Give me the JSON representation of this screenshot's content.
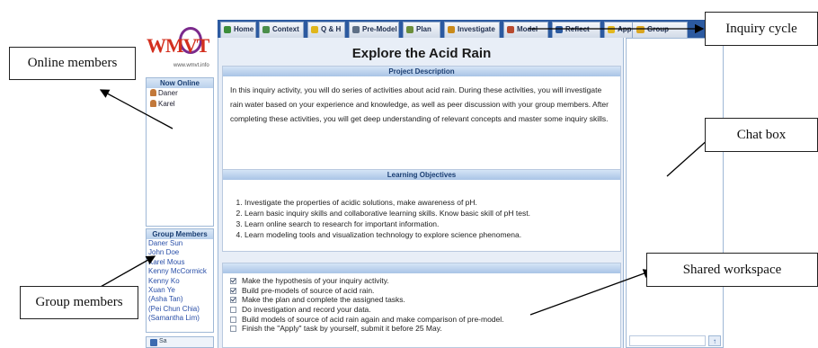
{
  "logo": {
    "text": "WMVT",
    "url_text": "www.wmvt.info"
  },
  "online_panel": {
    "title": "Now Online",
    "users": [
      "Daner",
      "Karel"
    ]
  },
  "members_panel": {
    "title": "Group Members",
    "members": [
      "Daner Sun",
      "John Doe",
      "Karel Mous",
      "Kenny McCormick",
      "Kenny Ko",
      "Xuan Ye",
      "(Asha Tan)",
      "(Pei Chun Chia)",
      "(Samantha Lim)"
    ]
  },
  "bottom_button": {
    "label": "Sa"
  },
  "tabs": [
    {
      "label": "Home",
      "icon": "home-icon",
      "color": "#3c8d3a"
    },
    {
      "label": "Context",
      "icon": "globe-icon",
      "color": "#4a8e4a"
    },
    {
      "label": "Q & H",
      "icon": "question-icon",
      "color": "#e0b61c"
    },
    {
      "label": "Pre-Model",
      "icon": "model-icon",
      "color": "#5d6f86"
    },
    {
      "label": "Plan",
      "icon": "pencil-icon",
      "color": "#6b8e3a"
    },
    {
      "label": "Investigate",
      "icon": "flask-icon",
      "color": "#c98a1a"
    },
    {
      "label": "Model",
      "icon": "molecule-icon",
      "color": "#b84a2f"
    },
    {
      "label": "Reflect",
      "icon": "reflect-icon",
      "color": "#2c5aa0"
    },
    {
      "label": "Apply",
      "icon": "star-icon",
      "color": "#e3b81f"
    }
  ],
  "group_tab": {
    "label": "Group",
    "icon": "group-icon"
  },
  "main": {
    "title": "Explore the Acid Rain",
    "description": {
      "header": "Project Description",
      "text": "In this inquiry activity, you will do series of activities about acid rain. During these activities, you will investigate rain water based on your experience and knowledge, as well as peer discussion with your group members. After completing these activities, you will get deep understanding of relevant concepts and master some inquiry skills."
    },
    "objectives": {
      "header": "Learning Objectives",
      "items": [
        "Investigate the properties of acidic solutions, make awareness of pH.",
        "Learn basic inquiry skills and collaborative learning skills. Know basic skill of pH test.",
        "Learn online search to research for important information.",
        "Learn modeling tools and visualization technology to explore science phenomena."
      ]
    },
    "tasks": {
      "header": "",
      "items": [
        {
          "text": "Make the hypothesis of your inquiry activity.",
          "checked": true
        },
        {
          "text": "Build pre-models of source of acid rain.",
          "checked": true
        },
        {
          "text": "Make the plan and complete the assigned tasks.",
          "checked": true
        },
        {
          "text": "Do investigation and record your data.",
          "checked": false
        },
        {
          "text": "Build models of source of acid rain again and make comparison of pre-model.",
          "checked": false
        },
        {
          "text": "Finish the \"Apply\" task by yourself, submit it before 25 May.",
          "checked": false
        }
      ]
    }
  },
  "chat": {
    "send_label": "↑"
  },
  "annotations": {
    "online_members": "Online members",
    "inquiry_cycle": "Inquiry cycle",
    "chat_box": "Chat box",
    "shared_workspace": "Shared workspace",
    "group_members": "Group members"
  },
  "colors": {
    "tabbar": "#2c5aa0",
    "panel_header": "#b9d0ec",
    "workspace_bg": "#e8eef7",
    "member_link": "#2a4fa8"
  }
}
